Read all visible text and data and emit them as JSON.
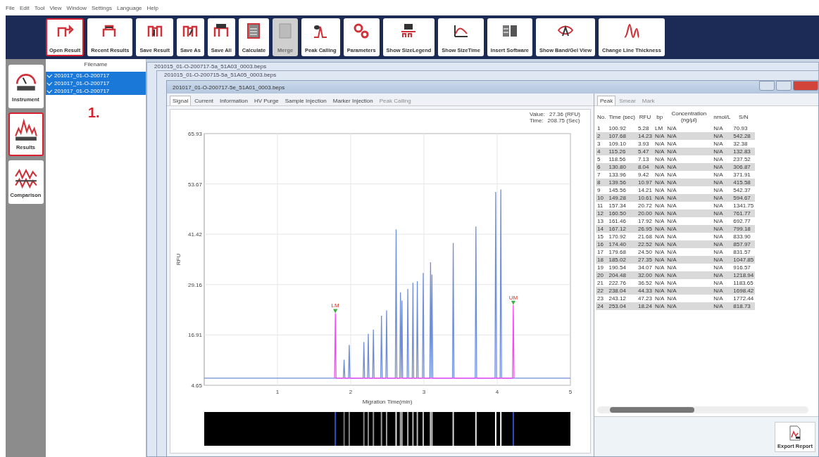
{
  "menu": [
    "File",
    "Edit",
    "Tool",
    "View",
    "Window",
    "Settings",
    "Language",
    "Help"
  ],
  "toolbar": [
    {
      "label": "Open Result",
      "selected": true,
      "disabled": false
    },
    {
      "label": "Recent Results",
      "selected": false,
      "disabled": false
    },
    {
      "label": "Save Result",
      "selected": false,
      "disabled": false
    },
    {
      "label": "Save As",
      "selected": false,
      "disabled": false
    },
    {
      "label": "Save All",
      "selected": false,
      "disabled": false
    },
    {
      "label": "Calculate",
      "selected": false,
      "disabled": false
    },
    {
      "label": "Merge",
      "selected": false,
      "disabled": true
    },
    {
      "label": "Peak Calling",
      "selected": false,
      "disabled": false
    },
    {
      "label": "Parameters",
      "selected": false,
      "disabled": false
    },
    {
      "label": "Show SizeLegend",
      "selected": false,
      "disabled": false
    },
    {
      "label": "Show SizeTime",
      "selected": false,
      "disabled": false
    },
    {
      "label": "Insert Software",
      "selected": false,
      "disabled": false
    },
    {
      "label": "Show Band/Gel View",
      "selected": false,
      "disabled": false
    },
    {
      "label": "Change Line Thickness",
      "selected": false,
      "disabled": false
    }
  ],
  "nav": [
    {
      "label": "Instrument",
      "selected": false
    },
    {
      "label": "Results",
      "selected": true
    },
    {
      "label": "Comparison",
      "selected": false
    }
  ],
  "files": {
    "header": "Filename",
    "items": [
      {
        "name": "201017_01-O-200717",
        "checked": true,
        "selected": true
      },
      {
        "name": "201017_01-O-200717",
        "checked": true,
        "selected": true
      },
      {
        "name": "201017_01-O-200717",
        "checked": true,
        "selected": true
      }
    ]
  },
  "annotation": "1.",
  "back_windows": [
    "201015_01-O-200717-5a_51A03_0003.beps",
    "201015_01-O-200715-5a_51A05_0003.beps"
  ],
  "window": {
    "title": "201017_01-O-200717-5e_51A01_0003.beps",
    "tabs": [
      {
        "label": "Signal",
        "selected": true,
        "disabled": false
      },
      {
        "label": "Current",
        "selected": false,
        "disabled": false
      },
      {
        "label": "Information",
        "selected": false,
        "disabled": false
      },
      {
        "label": "HV Purge",
        "selected": false,
        "disabled": false
      },
      {
        "label": "Sample Injection",
        "selected": false,
        "disabled": false
      },
      {
        "label": "Marker Injection",
        "selected": false,
        "disabled": false
      },
      {
        "label": "Peak Calling",
        "selected": false,
        "disabled": true
      }
    ],
    "readout": [
      {
        "label": "Value:",
        "value": "27.36 (RFU)"
      },
      {
        "label": "Time:",
        "value": "208.75 (Sec)"
      }
    ],
    "chart_data": {
      "type": "line",
      "xlabel": "Migration Time(min)",
      "ylabel": "RFU",
      "xlim": [
        0,
        5
      ],
      "ylim": [
        4.65,
        65.93
      ],
      "xticks": [
        1,
        2,
        3,
        4,
        5
      ],
      "yticks": [
        {
          "value": 4.65,
          "label": "4.65"
        },
        {
          "value": 16.91,
          "label": "16.91"
        },
        {
          "value": 29.16,
          "label": "29.16"
        },
        {
          "value": 41.42,
          "label": "41.42"
        },
        {
          "value": 53.67,
          "label": "53.67"
        },
        {
          "value": 65.93,
          "label": "65.93"
        }
      ],
      "grid": true,
      "series": [
        {
          "color": "#6f8ed8",
          "x": [
            0,
            1.9,
            1.91,
            1.92,
            1.97,
            1.98,
            1.99,
            2.17,
            2.18,
            2.19,
            2.23,
            2.24,
            2.25,
            2.3,
            2.31,
            2.32,
            2.41,
            2.42,
            2.43,
            2.48,
            2.49,
            2.5,
            2.61,
            2.62,
            2.63,
            2.67,
            2.68,
            2.69,
            2.69,
            2.7,
            2.71,
            2.77,
            2.78,
            2.79,
            2.84,
            2.85,
            2.86,
            2.9,
            2.91,
            2.92,
            2.98,
            2.99,
            3.0,
            3.08,
            3.09,
            3.1,
            3.1,
            3.11,
            3.12,
            3.39,
            3.4,
            3.41,
            3.7,
            3.71,
            3.72,
            3.97,
            3.98,
            3.99,
            4.04,
            4.05,
            4.06,
            5
          ],
          "values": [
            6.4,
            6.4,
            10.9,
            6.4,
            6.4,
            14.5,
            6.4,
            6.4,
            15.2,
            6.4,
            6.4,
            17.2,
            6.4,
            6.4,
            18.2,
            6.4,
            6.4,
            21.6,
            6.4,
            6.4,
            22.9,
            6.4,
            6.4,
            42.6,
            6.4,
            6.4,
            27.3,
            6.4,
            6.4,
            25.3,
            6.4,
            6.4,
            28.1,
            6.4,
            6.4,
            29.6,
            6.4,
            6.4,
            30.0,
            6.4,
            6.4,
            32.0,
            6.4,
            6.4,
            34.6,
            6.4,
            6.4,
            31.6,
            6.4,
            6.4,
            39.3,
            6.4,
            6.4,
            43.3,
            6.4,
            6.4,
            51.7,
            6.4,
            6.4,
            52.3,
            6.4,
            6.4
          ]
        },
        {
          "color": "#ff40ff",
          "x": [
            1.78,
            1.79,
            1.8,
            4.21,
            4.22,
            4.23
          ],
          "values": [
            6.4,
            22.2,
            6.4,
            6.4,
            24.2,
            6.4
          ]
        }
      ],
      "annotations": [
        {
          "x": 1.79,
          "y": 22.2,
          "text": "LM"
        },
        {
          "x": 4.22,
          "y": 24.2,
          "text": "UM"
        }
      ]
    },
    "results": {
      "tabs": [
        {
          "label": "Peak",
          "selected": true,
          "disabled": false
        },
        {
          "label": "Smear",
          "selected": false,
          "disabled": true
        },
        {
          "label": "Mark",
          "selected": false,
          "disabled": true
        }
      ],
      "columns": [
        "No.",
        "Time (sec)",
        "RFU",
        "bp",
        "Concentration (ng/µl)",
        "nmol/L",
        "S/N"
      ],
      "rows": [
        [
          "1",
          "100.92",
          "5.28",
          "LM",
          "N/A",
          "N/A",
          "70.93"
        ],
        [
          "2",
          "107.68",
          "14.23",
          "N/A",
          "N/A",
          "N/A",
          "542.28"
        ],
        [
          "3",
          "109.10",
          "3.93",
          "N/A",
          "N/A",
          "N/A",
          "32.38"
        ],
        [
          "4",
          "115.26",
          "5.47",
          "N/A",
          "N/A",
          "N/A",
          "132.83"
        ],
        [
          "5",
          "118.56",
          "7.13",
          "N/A",
          "N/A",
          "N/A",
          "237.52"
        ],
        [
          "6",
          "130.80",
          "8.04",
          "N/A",
          "N/A",
          "N/A",
          "306.87"
        ],
        [
          "7",
          "133.96",
          "9.42",
          "N/A",
          "N/A",
          "N/A",
          "371.91"
        ],
        [
          "8",
          "139.56",
          "10.97",
          "N/A",
          "N/A",
          "N/A",
          "415.58"
        ],
        [
          "9",
          "145.56",
          "14.21",
          "N/A",
          "N/A",
          "N/A",
          "542.37"
        ],
        [
          "10",
          "149.28",
          "10.61",
          "N/A",
          "N/A",
          "N/A",
          "594.67"
        ],
        [
          "11",
          "157.34",
          "20.72",
          "N/A",
          "N/A",
          "N/A",
          "1341.75"
        ],
        [
          "12",
          "160.50",
          "20.00",
          "N/A",
          "N/A",
          "N/A",
          "761.77"
        ],
        [
          "13",
          "161.46",
          "17.92",
          "N/A",
          "N/A",
          "N/A",
          "692.77"
        ],
        [
          "14",
          "167.12",
          "26.95",
          "N/A",
          "N/A",
          "N/A",
          "799.18"
        ],
        [
          "15",
          "170.92",
          "21.68",
          "N/A",
          "N/A",
          "N/A",
          "833.90"
        ],
        [
          "16",
          "174.40",
          "22.52",
          "N/A",
          "N/A",
          "N/A",
          "857.97"
        ],
        [
          "17",
          "179.68",
          "24.50",
          "N/A",
          "N/A",
          "N/A",
          "831.57"
        ],
        [
          "18",
          "185.02",
          "27.35",
          "N/A",
          "N/A",
          "N/A",
          "1047.85"
        ],
        [
          "19",
          "190.54",
          "34.07",
          "N/A",
          "N/A",
          "N/A",
          "916.57"
        ],
        [
          "20",
          "204.48",
          "32.00",
          "N/A",
          "N/A",
          "N/A",
          "1218.94"
        ],
        [
          "21",
          "222.76",
          "36.52",
          "N/A",
          "N/A",
          "N/A",
          "1183.65"
        ],
        [
          "22",
          "238.04",
          "44.33",
          "N/A",
          "N/A",
          "N/A",
          "1698.42"
        ],
        [
          "23",
          "243.12",
          "47.23",
          "N/A",
          "N/A",
          "N/A",
          "1772.44"
        ],
        [
          "24",
          "253.04",
          "18.24",
          "N/A",
          "N/A",
          "N/A",
          "818.73"
        ]
      ]
    },
    "export_button": "Export Report"
  }
}
